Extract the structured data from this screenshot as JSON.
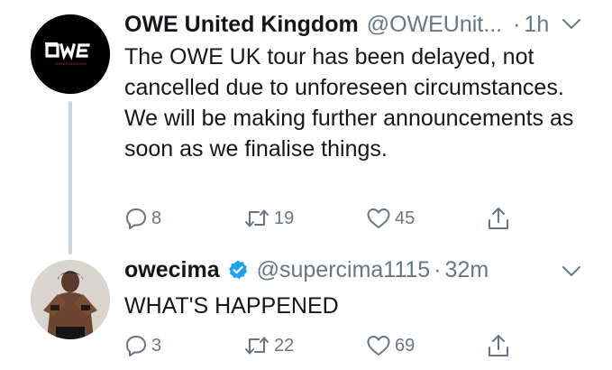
{
  "tweets": [
    {
      "display_name": "OWE United Kingdom",
      "handle": "@OWEUnit...",
      "separator": "·",
      "time": "1h",
      "verified": false,
      "avatar": {
        "logo_text": "OWE",
        "logo_subtext": "UNITED KINGDOM"
      },
      "text": "The OWE UK tour has been delayed, not cancelled due to unforeseen circumstances.  We will be making further announcements as soon as we finalise things.",
      "replies": "8",
      "retweets": "19",
      "likes": "45"
    },
    {
      "display_name": "owecima",
      "handle": "@supercima1115",
      "separator": "·",
      "time": "32m",
      "verified": true,
      "text": "WHAT'S HAPPENED",
      "replies": "3",
      "retweets": "22",
      "likes": "69"
    }
  ],
  "icons": {
    "reply": "reply-icon",
    "retweet": "retweet-icon",
    "like": "heart-icon",
    "share": "share-icon",
    "more": "chevron-down-icon",
    "verified": "verified-badge-icon"
  },
  "colors": {
    "text": "#14171a",
    "secondary": "#657786",
    "thread_line": "#ccd6dd",
    "verified": "#1da1f2"
  }
}
